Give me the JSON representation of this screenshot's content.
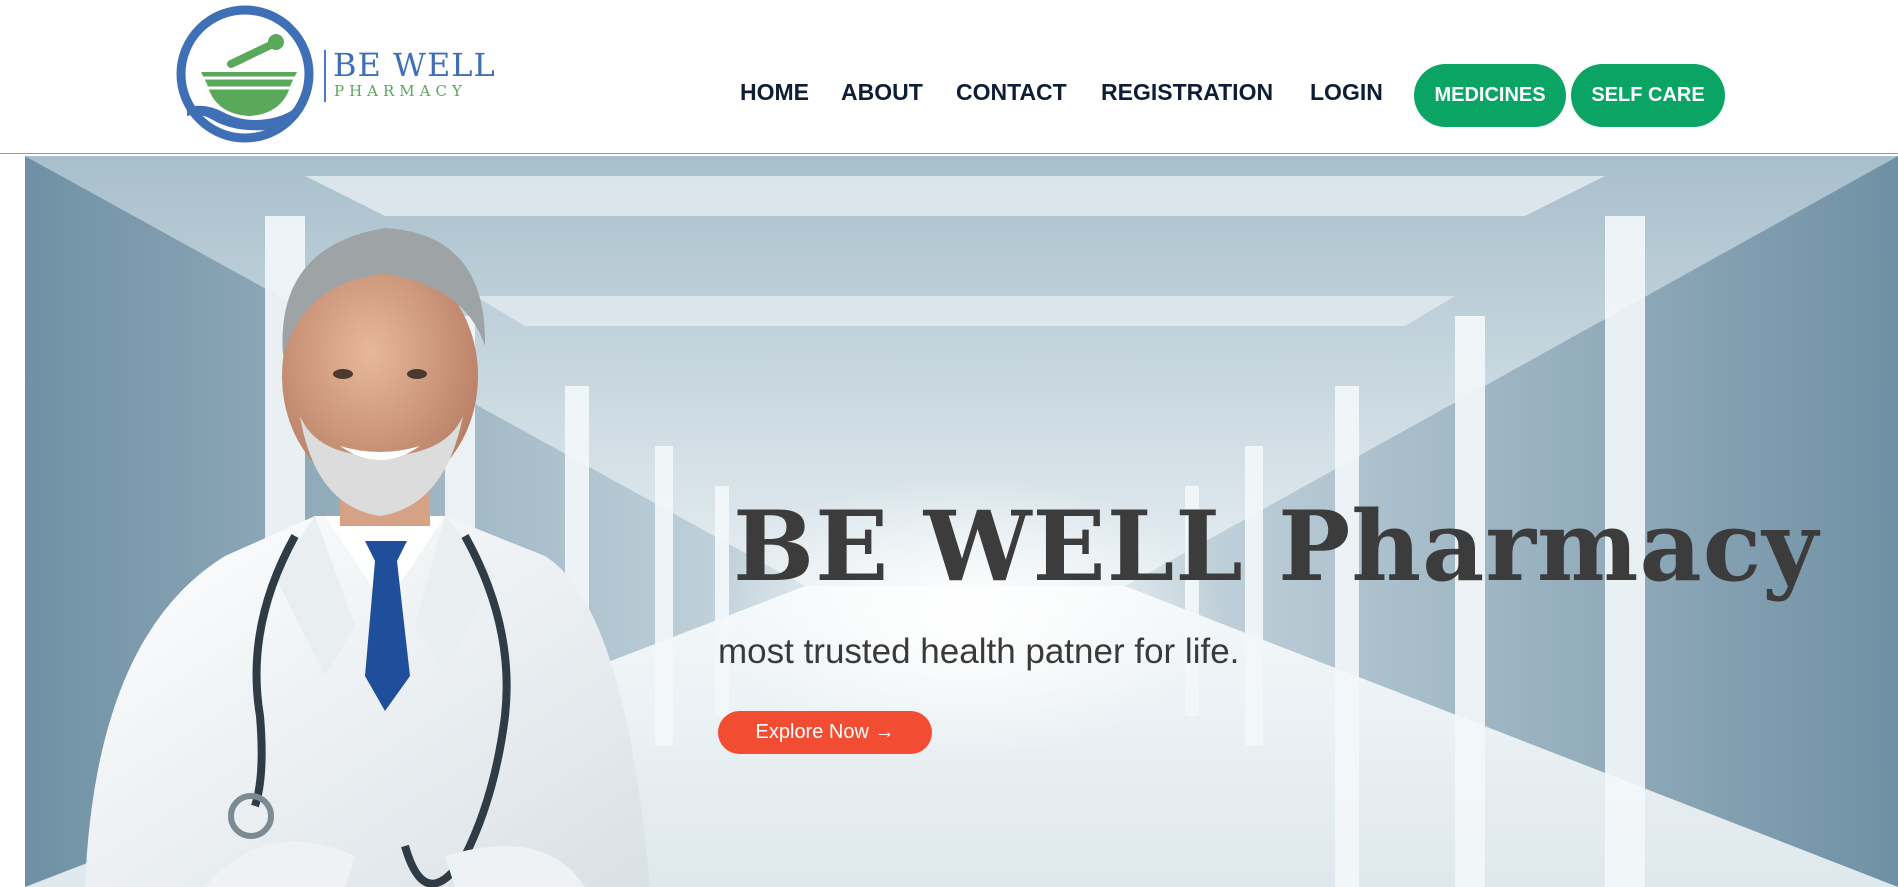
{
  "brand": {
    "title": "BE WELL",
    "subtitle": "PHARMACY",
    "logo_icon": "mortar-pestle-hand-icon"
  },
  "nav": {
    "items": [
      "HOME",
      "ABOUT",
      "CONTACT",
      "REGISTRATION",
      "LOGIN"
    ],
    "medicines_label": "MEDICINES",
    "self_care_label": "SELF CARE"
  },
  "hero": {
    "title": "BE WELL Pharmacy",
    "subtitle": "most trusted health patner for life.",
    "cta_label": "Explore Now →",
    "image_description_icon": "doctor-photo"
  },
  "colors": {
    "nav_text": "#0f1e34",
    "pill_green": "#0aa465",
    "cta_red": "#f24d32",
    "logo_blue": "#3f6fb5",
    "logo_green": "#5aa85a"
  }
}
